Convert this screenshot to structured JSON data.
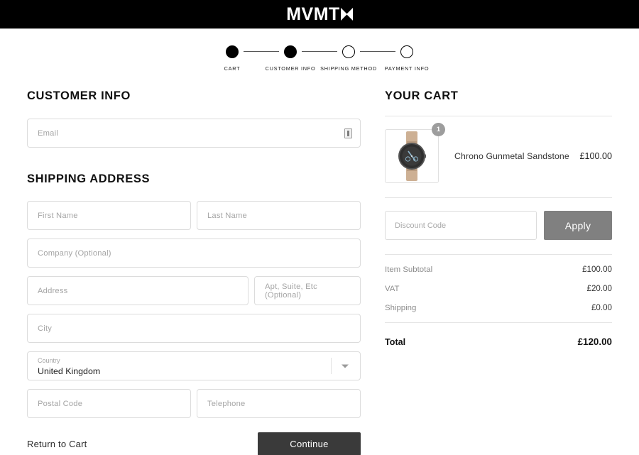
{
  "header": {
    "brand": "MVMT",
    "brand_mark": "hourglass-mark"
  },
  "stepper": {
    "steps": [
      {
        "label": "CART",
        "state": "complete"
      },
      {
        "label": "CUSTOMER INFO",
        "state": "complete"
      },
      {
        "label": "SHIPPING METHOD",
        "state": "upcoming"
      },
      {
        "label": "PAYMENT INFO",
        "state": "upcoming"
      }
    ]
  },
  "customer_info": {
    "title": "CUSTOMER INFO",
    "email": {
      "placeholder": "Email",
      "value": ""
    }
  },
  "shipping_address": {
    "title": "SHIPPING ADDRESS",
    "first_name": {
      "placeholder": "First Name",
      "value": ""
    },
    "last_name": {
      "placeholder": "Last Name",
      "value": ""
    },
    "company": {
      "placeholder": "Company (Optional)",
      "value": ""
    },
    "address": {
      "placeholder": "Address",
      "value": ""
    },
    "apt": {
      "placeholder": "Apt, Suite, Etc (Optional)",
      "value": ""
    },
    "city": {
      "placeholder": "City",
      "value": ""
    },
    "country": {
      "label": "Country",
      "value": "United Kingdom"
    },
    "postal_code": {
      "placeholder": "Postal Code",
      "value": ""
    },
    "telephone": {
      "placeholder": "Telephone",
      "value": ""
    }
  },
  "actions": {
    "return_to_cart": "Return to Cart",
    "continue": "Continue",
    "continue_bg": "#3a3a3a"
  },
  "cart": {
    "title": "YOUR CART",
    "items": [
      {
        "name": "Chrono Gunmetal Sandstone",
        "price": "£100.00",
        "quantity": "1"
      }
    ],
    "discount": {
      "placeholder": "Discount Code",
      "value": "",
      "apply_label": "Apply",
      "apply_bg": "#808080"
    },
    "totals": [
      {
        "label": "Item Subtotal",
        "value": "£100.00"
      },
      {
        "label": "VAT",
        "value": "£20.00"
      },
      {
        "label": "Shipping",
        "value": "£0.00"
      }
    ],
    "grand_total": {
      "label": "Total",
      "value": "£120.00"
    }
  }
}
